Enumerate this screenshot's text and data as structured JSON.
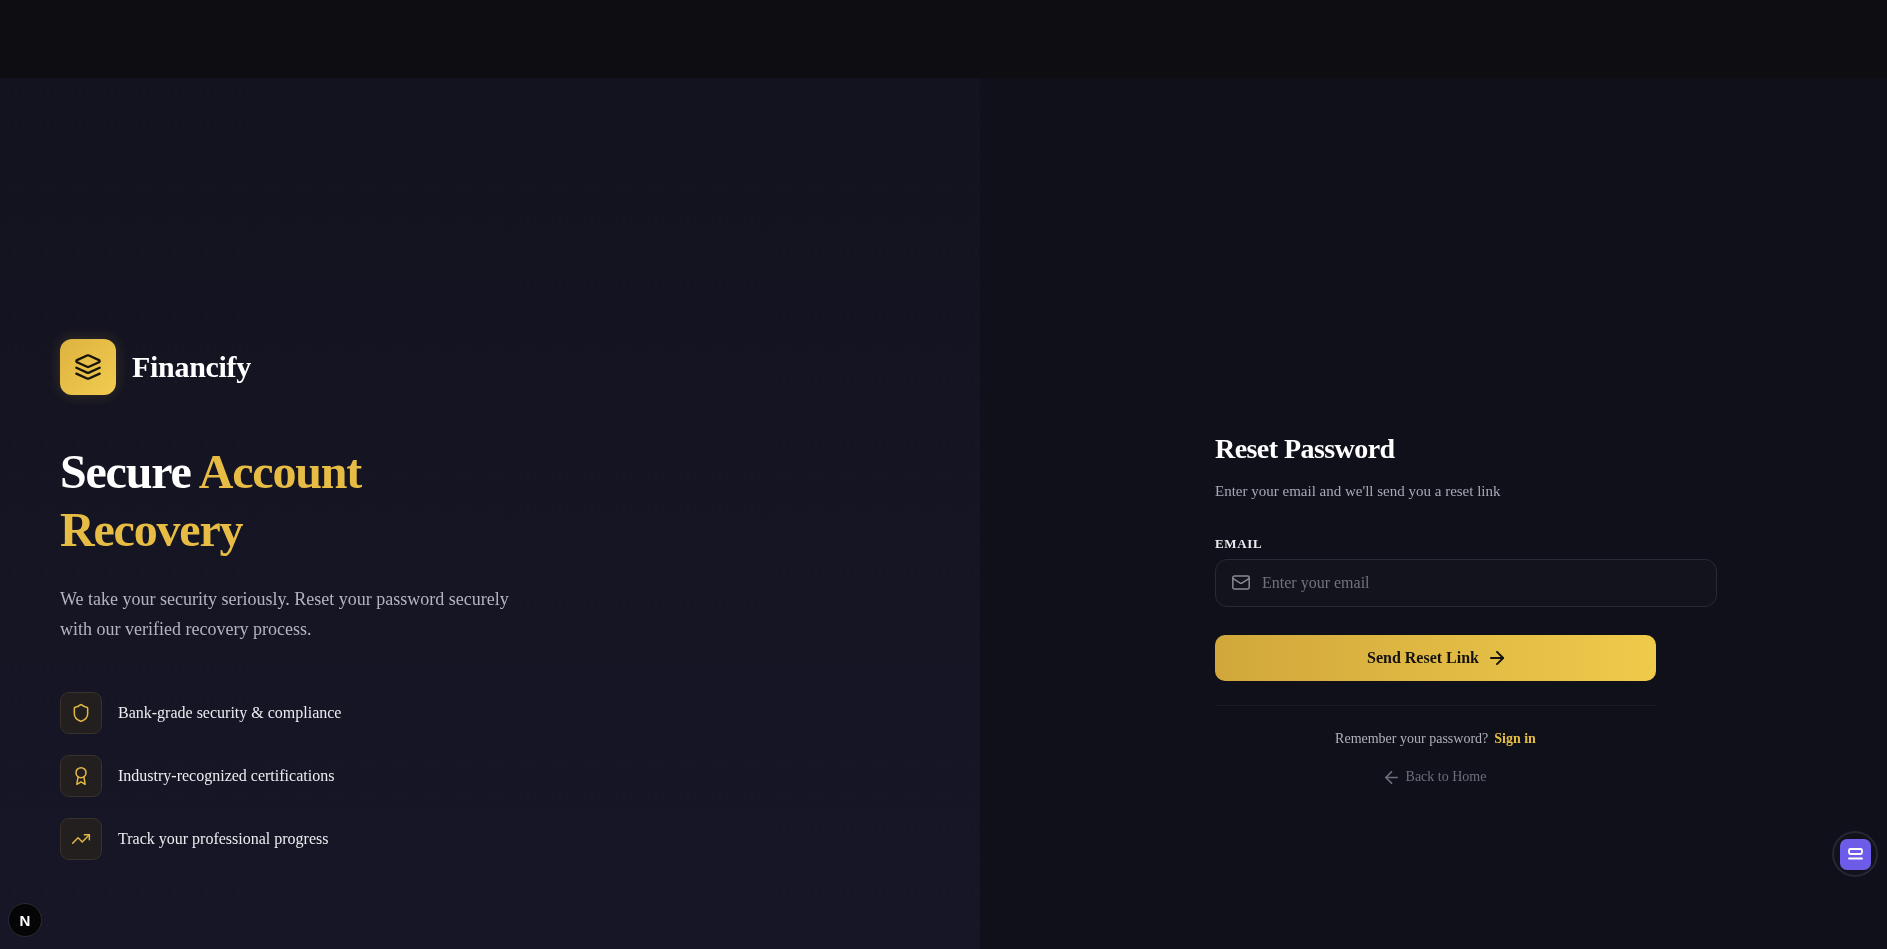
{
  "brand": {
    "name": "Financify"
  },
  "hero": {
    "headline": {
      "lead": "Secure",
      "accent": "Account Recovery"
    },
    "description": "We take your security seriously. Reset your password securely with our verified recovery process.",
    "features": [
      {
        "label": "Bank-grade security & compliance"
      },
      {
        "label": "Industry-recognized certifications"
      },
      {
        "label": "Track your professional progress"
      }
    ]
  },
  "form": {
    "title": "Reset Password",
    "subtitle": "Enter your email and we'll send you a reset link",
    "email": {
      "label": "EMAIL",
      "placeholder": "Enter your email"
    },
    "submit": "Send Reset Link",
    "signin_prompt": "Remember your password?",
    "signin_link": "Sign in",
    "back_link": "Back to Home"
  },
  "dev_badge": {
    "label": "N"
  }
}
